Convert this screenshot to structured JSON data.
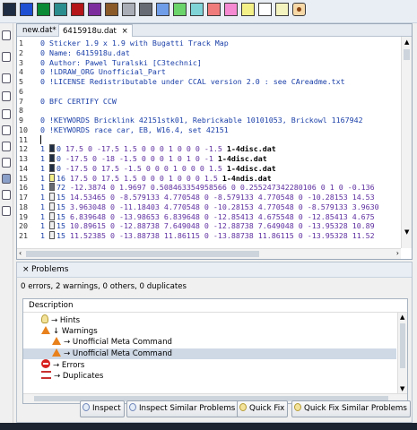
{
  "palette": {
    "colors": [
      "#1f2d44",
      "#1e4fd3",
      "#0a8a34",
      "#2c8d8e",
      "#b31519",
      "#7d2c9e",
      "#8a5a29",
      "#a8adb6",
      "#666b74",
      "#6f9de8",
      "#6bd46b",
      "#7fd4d8",
      "#f07b7b",
      "#f68ad2",
      "#f4f088",
      "#ffffff",
      "#f4f4c0"
    ],
    "extra_icon": "paint-palette-icon"
  },
  "tabs": [
    {
      "label": "new.dat*"
    },
    {
      "label": "6415918u.dat",
      "close": "×"
    }
  ],
  "code_lines": [
    {
      "n": "1",
      "t": "0 Sticker 1.9 x 1.9 with Bugatti Track Map",
      "k": "blue"
    },
    {
      "n": "2",
      "t": "0 Name: 6415918u.dat",
      "k": "blue"
    },
    {
      "n": "3",
      "t": "0 Author: Pawel Turalski [C3technic]",
      "k": "blue"
    },
    {
      "n": "4",
      "t": "0 !LDRAW_ORG Unofficial_Part",
      "k": "blue"
    },
    {
      "n": "5",
      "t": "0 !LICENSE Redistributable under CCAL version 2.0 : see CAreadme.txt",
      "k": "blue"
    },
    {
      "n": "6",
      "t": "",
      "k": "t1"
    },
    {
      "n": "7",
      "t": "0 BFC CERTIFY CCW",
      "k": "blue"
    },
    {
      "n": "8",
      "t": "",
      "k": "t1"
    },
    {
      "n": "9",
      "t": "0 !KEYWORDS Bricklink 42151stk01, Rebrickable 10101053, Brickowl 1167942",
      "k": "blue"
    },
    {
      "n": "10",
      "t": "0 !KEYWORDS race car, EB, W16.4, set 42151",
      "k": "blue"
    },
    {
      "n": "11",
      "t": "",
      "k": "t1"
    },
    {
      "n": "12",
      "c": "0",
      "t": "17.5 0 -17.5 1.5 0 0 0 1 0 0 0 -1.5 ",
      "b": "1-4disc.dat",
      "k": "num"
    },
    {
      "n": "13",
      "c": "0",
      "t": "-17.5 0 -18 -1.5 0 0 0 1 0 1 0 -1 ",
      "b": "1-4disc.dat",
      "k": "num"
    },
    {
      "n": "14",
      "c": "0",
      "t": "-17.5 0 17.5 -1.5 0 0 0 1 0 0 0 1.5 ",
      "b": "1-4disc.dat",
      "k": "num"
    },
    {
      "n": "15",
      "c": "16",
      "t": "17.5 0 17.5 1.5 0 0 0 1 0 0 0 1.5 ",
      "b": "1-4ndis.dat",
      "k": "num"
    },
    {
      "n": "16",
      "c": "72",
      "t": "-12.3874 0 1.9697 0.508463354958566 0 0.255247342280106 0 1 0 -0.136",
      "k": "num"
    },
    {
      "n": "17",
      "c": "15",
      "t": "14.53465 0 -8.579133 4.770548 0 -8.579133 4.770548 0 -10.28153 14.53",
      "k": "num"
    },
    {
      "n": "18",
      "c": "15",
      "t": "3.963048 0 -11.18403 4.770548 0 -10.28153 4.770548 0 -8.579133 3.9630",
      "k": "num"
    },
    {
      "n": "19",
      "c": "15",
      "t": "6.839648 0 -13.98653 6.839648 0 -12.85413 4.675548 0 -12.85413 4.675",
      "k": "num"
    },
    {
      "n": "20",
      "c": "15",
      "t": "10.89615 0 -12.88738 7.649048 0 -12.88738 7.649048 0 -13.95328 10.89",
      "k": "num"
    },
    {
      "n": "21",
      "c": "15",
      "t": "11.52385 0 -13.88738 11.86115 0 -13.88738 11.86115 0 -13.95328 11.52",
      "k": "num"
    }
  ],
  "problems": {
    "title": "Problems",
    "close": "×",
    "summary": "0 errors, 2 warnings, 0 others, 0 duplicates",
    "column": "Description",
    "rows": [
      {
        "label": "→ Hints",
        "icon": "bulb",
        "indent": 1
      },
      {
        "label": "↓ Warnings",
        "icon": "warn",
        "indent": 1
      },
      {
        "label": "→ Unofficial Meta Command",
        "icon": "warn",
        "indent": 2
      },
      {
        "label": "→ Unofficial Meta Command",
        "icon": "warn",
        "indent": 2,
        "selected": true
      },
      {
        "label": "→ Errors",
        "icon": "error",
        "indent": 1
      },
      {
        "label": "→ Duplicates",
        "icon": "dup",
        "indent": 1
      }
    ],
    "buttons": {
      "inspect": "Inspect",
      "inspect_similar": "Inspect Similar Problems",
      "quick_fix": "Quick Fix",
      "quick_fix_similar": "Quick Fix Similar Problems"
    }
  },
  "code_colors": {
    "0": "#1f2d44",
    "16": "#f4f088",
    "72": "#666b74",
    "15": "#f0f0f0"
  }
}
